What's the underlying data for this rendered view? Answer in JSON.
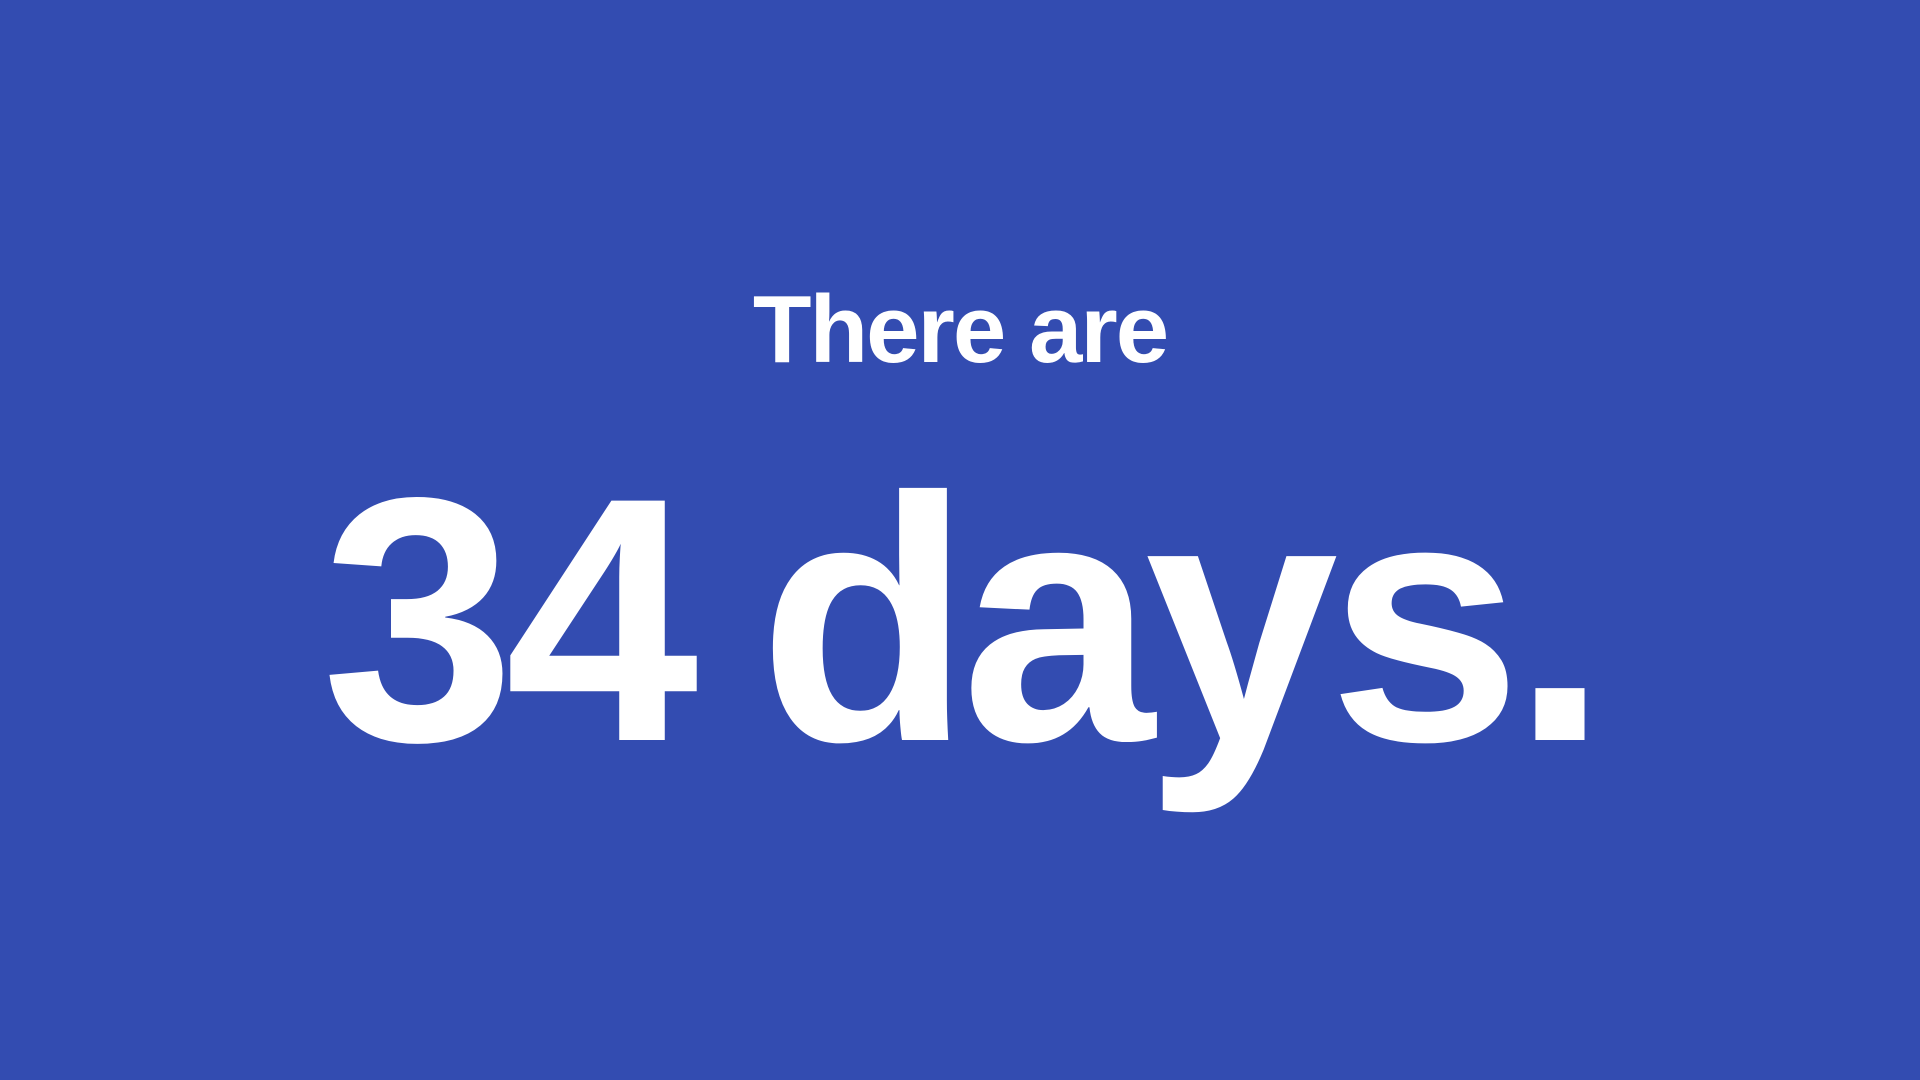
{
  "slide": {
    "intro_text": "There are",
    "count": "34",
    "unit": "days.",
    "background_color": "#334cb1",
    "text_color": "#ffffff"
  }
}
